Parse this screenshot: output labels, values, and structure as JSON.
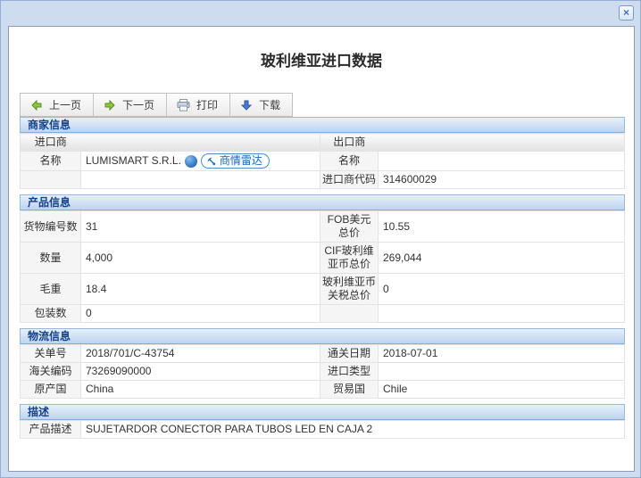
{
  "window": {
    "title": "玻利维亚进口数据",
    "close_glyph": "×"
  },
  "toolbar": {
    "prev_label": "上一页",
    "next_label": "下一页",
    "print_label": "打印",
    "download_label": "下载"
  },
  "merchant": {
    "section_title": "商家信息",
    "importer_header": "进口商",
    "exporter_header": "出口商",
    "name_label": "名称",
    "importer_name": "LUMISMART S.R.L.",
    "radar_badge_label": "商情雷达",
    "exporter_name_label": "名称",
    "exporter_name": "",
    "importer_code_label": "进口商代码",
    "importer_code": "314600029"
  },
  "product": {
    "section_title": "产品信息",
    "rows": [
      {
        "l_label": "货物编号数",
        "l_value": "31",
        "r_label": "FOB美元总价",
        "r_value": "10.55"
      },
      {
        "l_label": "数量",
        "l_value": "4,000",
        "r_label": "CIF玻利维亚币总价",
        "r_value": "269,044"
      },
      {
        "l_label": "毛重",
        "l_value": "18.4",
        "r_label": "玻利维亚币关税总价",
        "r_value": "0"
      },
      {
        "l_label": "包装数",
        "l_value": "0",
        "r_label": "",
        "r_value": ""
      }
    ]
  },
  "logistics": {
    "section_title": "物流信息",
    "rows": [
      {
        "l_label": "关单号",
        "l_value": "2018/701/C-43754",
        "r_label": "通关日期",
        "r_value": "2018-07-01"
      },
      {
        "l_label": "海关编码",
        "l_value": "73269090000",
        "r_label": "进口类型",
        "r_value": ""
      },
      {
        "l_label": "原产国",
        "l_value": "China",
        "r_label": "贸易国",
        "r_value": "Chile"
      }
    ]
  },
  "description": {
    "section_title": "描述",
    "label": "产品描述",
    "value": "SUJETARDOR CONECTOR PARA TUBOS LED EN CAJA 2"
  },
  "icons": {
    "close": "x-icon",
    "prev": "green-arrow-left-icon",
    "next": "green-arrow-right-icon",
    "print": "printer-icon",
    "download": "blue-arrow-down-icon",
    "globe": "globe-icon",
    "radar": "radar-dish-icon"
  },
  "colors": {
    "accent_blue": "#15428b",
    "frame_blue": "#cddcee",
    "section_header_gradient": "#bdd3ef",
    "radar_blue": "#1566b8",
    "green_arrow": "#8dc63f",
    "blue_arrow": "#4a77d4"
  }
}
